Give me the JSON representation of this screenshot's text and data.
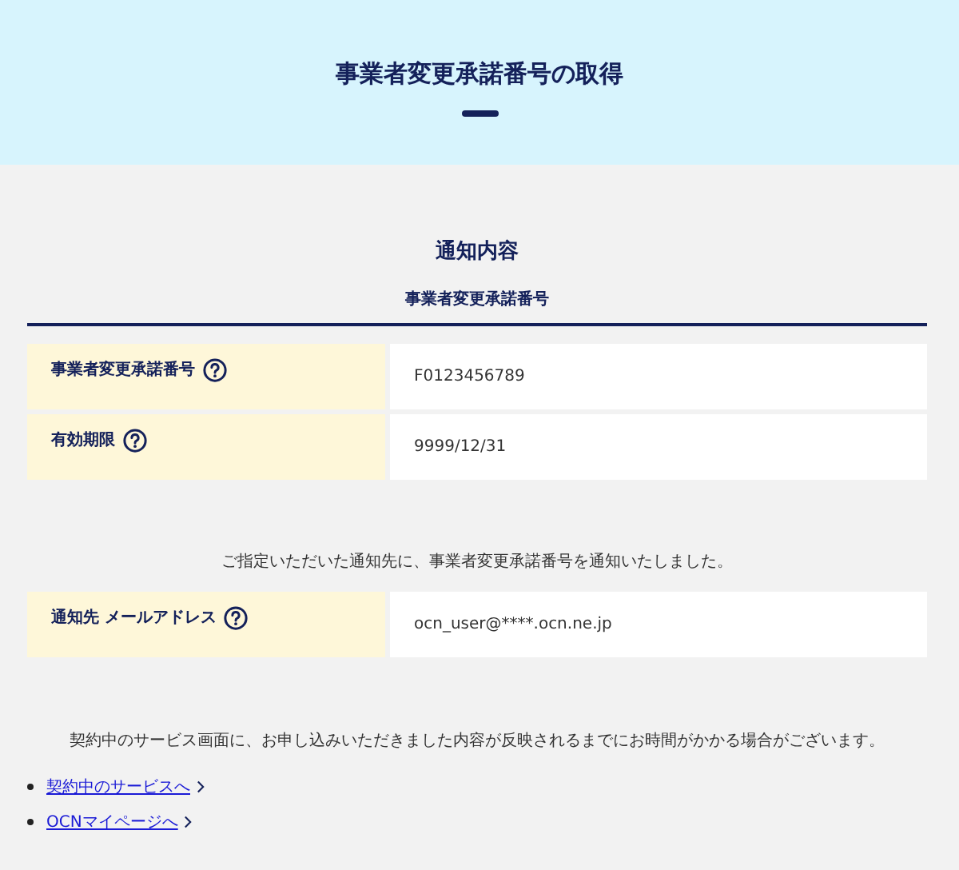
{
  "header": {
    "title": "事業者変更承諾番号の取得"
  },
  "section": {
    "title": "通知内容",
    "subtitle": "事業者変更承諾番号"
  },
  "details": [
    {
      "label": "事業者変更承諾番号",
      "value": "F0123456789"
    },
    {
      "label": "有効期限",
      "value": "9999/12/31"
    }
  ],
  "notice": "ご指定いただいた通知先に、事業者変更承諾番号を通知いたしました。",
  "contact": [
    {
      "label": "通知先 メールアドレス",
      "value": "ocn_user@****.ocn.ne.jp"
    }
  ],
  "note": "契約中のサービス画面に、お申し込みいただきました内容が反映されるまでにお時間がかかる場合がございます。",
  "links": [
    "契約中のサービスへ",
    "OCNマイページへ"
  ]
}
